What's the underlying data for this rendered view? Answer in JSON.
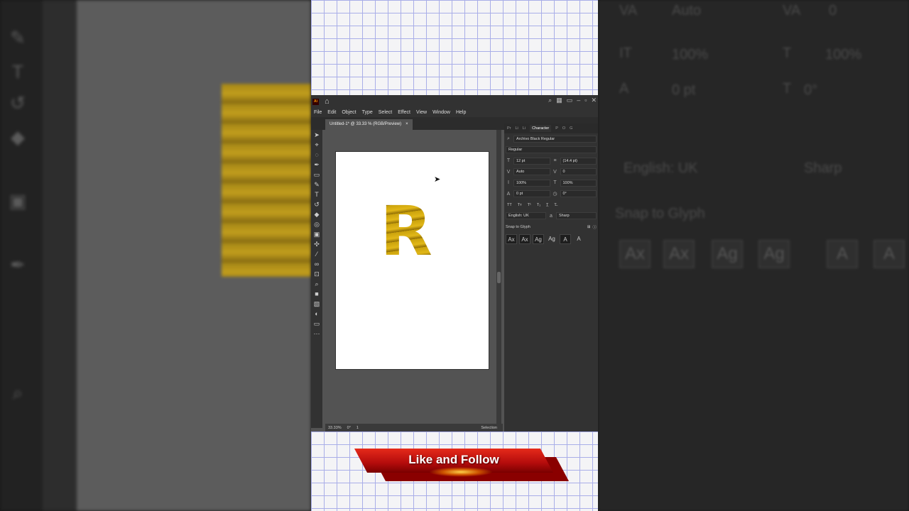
{
  "app": {
    "logo": "Ai",
    "menu": [
      "File",
      "Edit",
      "Object",
      "Type",
      "Select",
      "Effect",
      "View",
      "Window",
      "Help"
    ],
    "document_tab": "Untitled-1* @ 33.33 % (RGB/Preview)",
    "tab_close": "×"
  },
  "canvas": {
    "letter": "R",
    "fill_colors": [
      "#caa20c",
      "#e2b818",
      "#8e6c04"
    ]
  },
  "status": {
    "zoom": "33.33%",
    "rotation": "0°",
    "artboard": "1",
    "tool": "Selection"
  },
  "character_panel": {
    "tabs": [
      "Pr",
      "Li",
      "Li",
      "Character",
      "P",
      "O",
      "G"
    ],
    "font_family": "Archivo Black Regular",
    "font_style": "Regular",
    "font_size": "12 pt",
    "leading": "(14.4 pt)",
    "kerning": "Auto",
    "tracking": "0",
    "vertical_scale": "100%",
    "horizontal_scale": "100%",
    "baseline_shift": "0 pt",
    "rotation": "0°",
    "language": "English: UK",
    "antialias": "Sharp",
    "snap_label": "Snap to Glyph",
    "glyph_buttons": [
      "Ax",
      "Ax",
      "Ag",
      "Ag",
      "A",
      "A"
    ]
  },
  "background_right": {
    "kerning": "Auto",
    "tracking": "0",
    "vertical_scale": "100%",
    "horizontal_scale": "100%",
    "baseline_shift": "0 pt",
    "rotation": "0°",
    "language": "English: UK",
    "antialias": "Sharp",
    "snap_label": "Snap to Glyph"
  },
  "banner": {
    "text": "Like and Follow",
    "colors": {
      "primary": "#d21a12",
      "shadow": "#8a0000",
      "glow": "#ffd24a"
    }
  }
}
